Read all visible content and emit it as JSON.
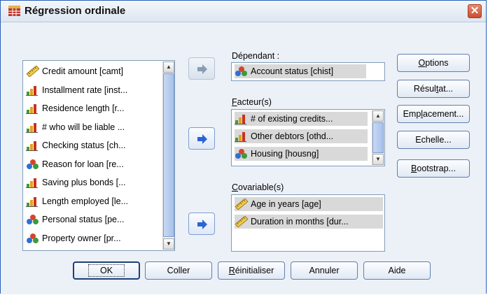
{
  "window": {
    "title": "Régression ordinale",
    "close_symbol": "✕"
  },
  "variables_list": {
    "items": [
      {
        "label": "Credit amount [camt]",
        "icon": "ruler-scale-icon"
      },
      {
        "label": "Installment rate [inst...",
        "icon": "ordinal-bars-icon"
      },
      {
        "label": "Residence length [r...",
        "icon": "ordinal-bars-icon"
      },
      {
        "label": "# who will be liable ...",
        "icon": "ordinal-bars-icon"
      },
      {
        "label": "Checking status [ch...",
        "icon": "ordinal-bars-icon"
      },
      {
        "label": "Reason for loan [re...",
        "icon": "nominal-circles-icon"
      },
      {
        "label": "Saving plus bonds [...",
        "icon": "ordinal-bars-icon"
      },
      {
        "label": "Length employed [le...",
        "icon": "ordinal-bars-icon"
      },
      {
        "label": "Personal status [pe...",
        "icon": "nominal-circles-icon"
      },
      {
        "label": "Property owner [pr...",
        "icon": "nominal-circles-icon"
      }
    ]
  },
  "dependent": {
    "label": "Dépendant :",
    "item": {
      "label": "Account status [chist]",
      "icon": "nominal-circles-icon"
    }
  },
  "factors": {
    "label_prefix": "F",
    "label_rest": "acteur(s)",
    "items": [
      {
        "label": "# of existing credits...",
        "icon": "ordinal-bars-icon"
      },
      {
        "label": "Other debtors [othd...",
        "icon": "ordinal-bars-icon"
      },
      {
        "label": "Housing [housng]",
        "icon": "nominal-circles-icon"
      }
    ]
  },
  "covariates": {
    "label_prefix": "C",
    "label_rest": "ovariable(s)",
    "items": [
      {
        "label": "Age in years [age]",
        "icon": "ruler-scale-icon"
      },
      {
        "label": "Duration in months [dur...",
        "icon": "ruler-scale-icon"
      }
    ]
  },
  "side_buttons": {
    "options_u": "O",
    "options_rest": "ptions",
    "resultat_a": "Résul",
    "resultat_u": "t",
    "resultat_b": "at...",
    "emplacement_a": "Emp",
    "emplacement_u": "l",
    "emplacement_b": "acement...",
    "echelle": "Echelle...",
    "bootstrap_u": "B",
    "bootstrap_rest": "ootstrap..."
  },
  "bottom_buttons": {
    "ok": "OK",
    "coller": "Coller",
    "reinit_u": "R",
    "reinit_rest": "éinitialiser",
    "annuler": "Annuler",
    "aide": "Aide"
  },
  "colors": {
    "accent": "#1f5fd1",
    "selection": "#d9d9d9",
    "border": "#7f9db9"
  }
}
